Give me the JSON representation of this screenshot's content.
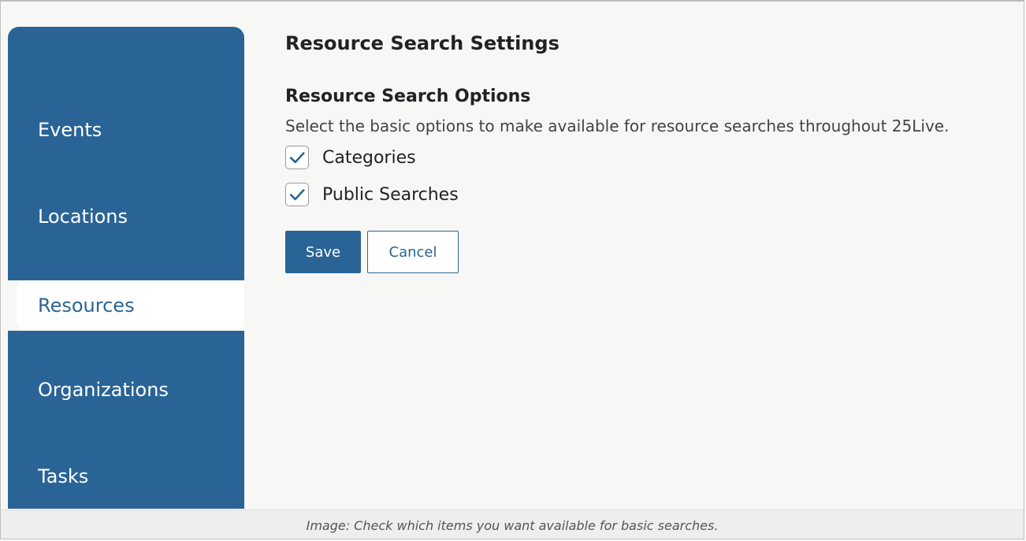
{
  "sidebar": {
    "items": [
      {
        "label": "Events",
        "active": false
      },
      {
        "label": "Locations",
        "active": false
      },
      {
        "label": "Resources",
        "active": true
      },
      {
        "label": "Organizations",
        "active": false
      },
      {
        "label": "Tasks",
        "active": false
      }
    ]
  },
  "main": {
    "title": "Resource Search Settings",
    "section_title": "Resource Search Options",
    "description": "Select the basic options to make available for resource searches throughout 25Live.",
    "options": [
      {
        "label": "Categories",
        "checked": true,
        "icon": "checkmark-icon"
      },
      {
        "label": "Public Searches",
        "checked": true,
        "icon": "checkmark-icon"
      }
    ],
    "buttons": {
      "save_label": "Save",
      "cancel_label": "Cancel"
    }
  },
  "caption": "Image: Check which items you want available for basic searches.",
  "colors": {
    "primary": "#2a6496",
    "page_background": "#f7f7f6",
    "caption_background": "#eeeeee"
  }
}
